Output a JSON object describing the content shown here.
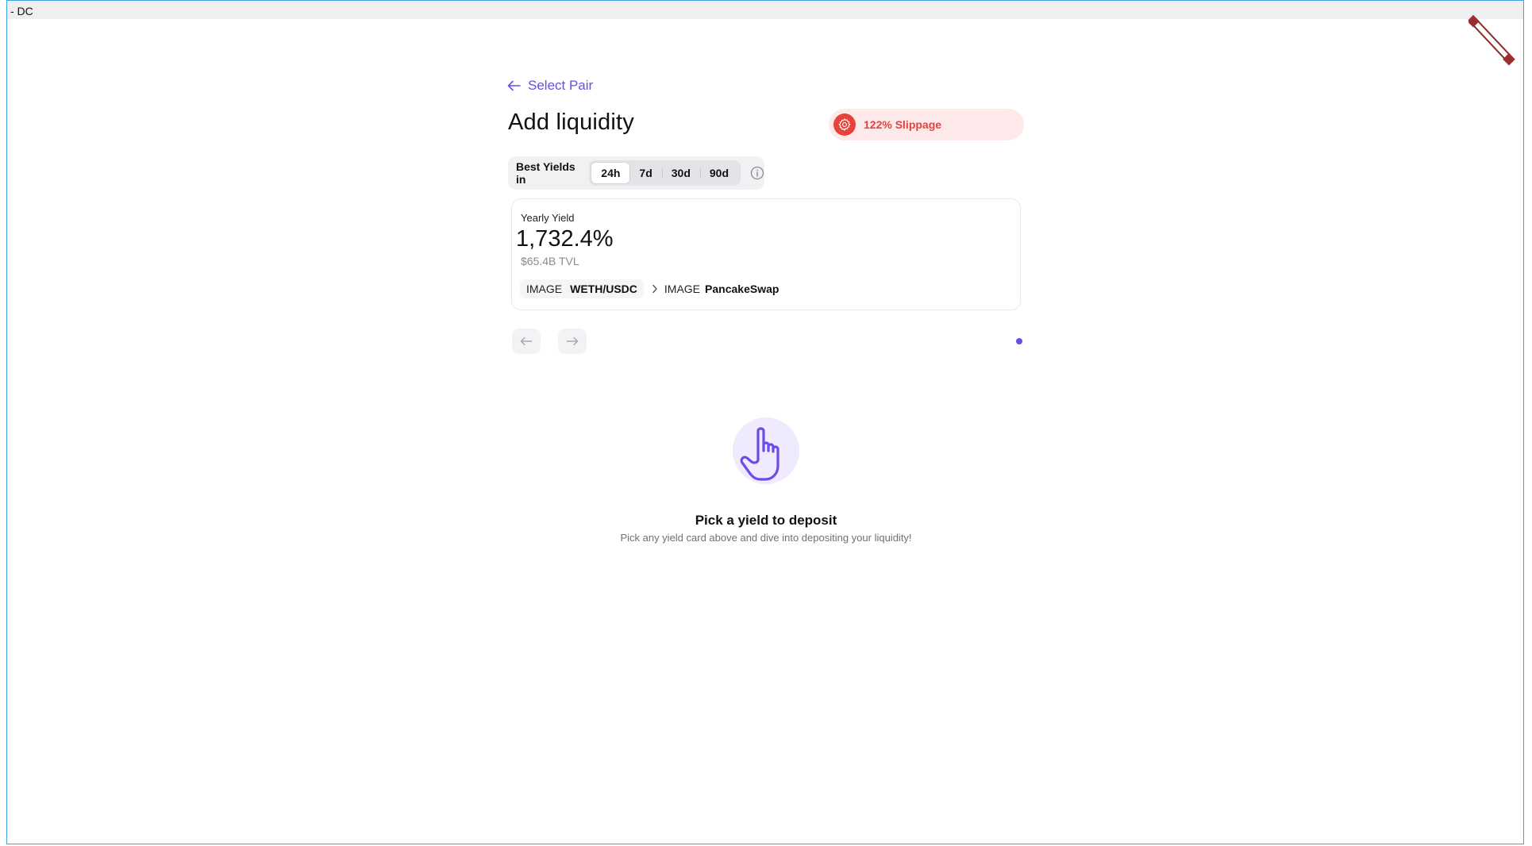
{
  "window": {
    "title": "- DC"
  },
  "header": {
    "back_label": "Select Pair",
    "title": "Add liquidity"
  },
  "slippage": {
    "label": "122% Slippage",
    "color": "#e8413b"
  },
  "yield_filter": {
    "label": "Best Yields in",
    "options": [
      "24h",
      "7d",
      "30d",
      "90d"
    ],
    "selected": "24h"
  },
  "yield_card": {
    "caption": "Yearly Yield",
    "value": "1,732.4%",
    "tvl": "$65.4B TVL",
    "pair": {
      "image_label": "IMAGE",
      "name": "WETH/USDC"
    },
    "protocol": {
      "image_label": "IMAGE",
      "name": "PancakeSwap"
    }
  },
  "empty_state": {
    "title": "Pick a yield to deposit",
    "subtitle": "Pick any yield card above and dive into depositing your liquidity!"
  },
  "accent_color": "#6b4ce6"
}
